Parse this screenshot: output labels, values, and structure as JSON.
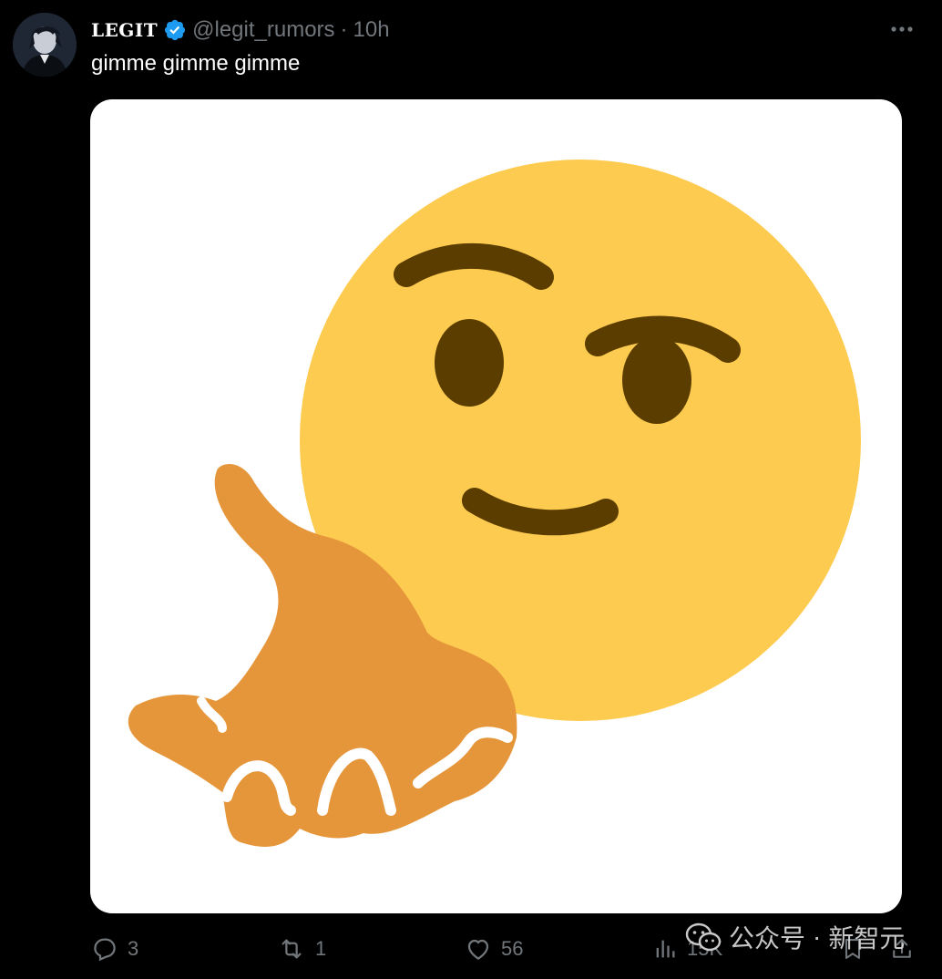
{
  "tweet": {
    "author": {
      "display_name": "LEGIT",
      "handle": "@legit_rumors",
      "verified": true
    },
    "separator": "·",
    "timestamp": "10h",
    "text": "gimme gimme gimme",
    "media": {
      "description_icon": "gimme-hand-emoji"
    },
    "actions": {
      "replies": "3",
      "reposts": "1",
      "likes": "56",
      "views": "15K"
    }
  },
  "watermark": {
    "source": "公众号",
    "separator": "·",
    "name": "新智元"
  },
  "colors": {
    "background": "#000000",
    "muted_text": "#71767b",
    "verified_blue": "#1d9bf0",
    "emoji_face": "#fdcb4f",
    "emoji_features": "#5c3d00",
    "emoji_hand": "#e6963a"
  }
}
